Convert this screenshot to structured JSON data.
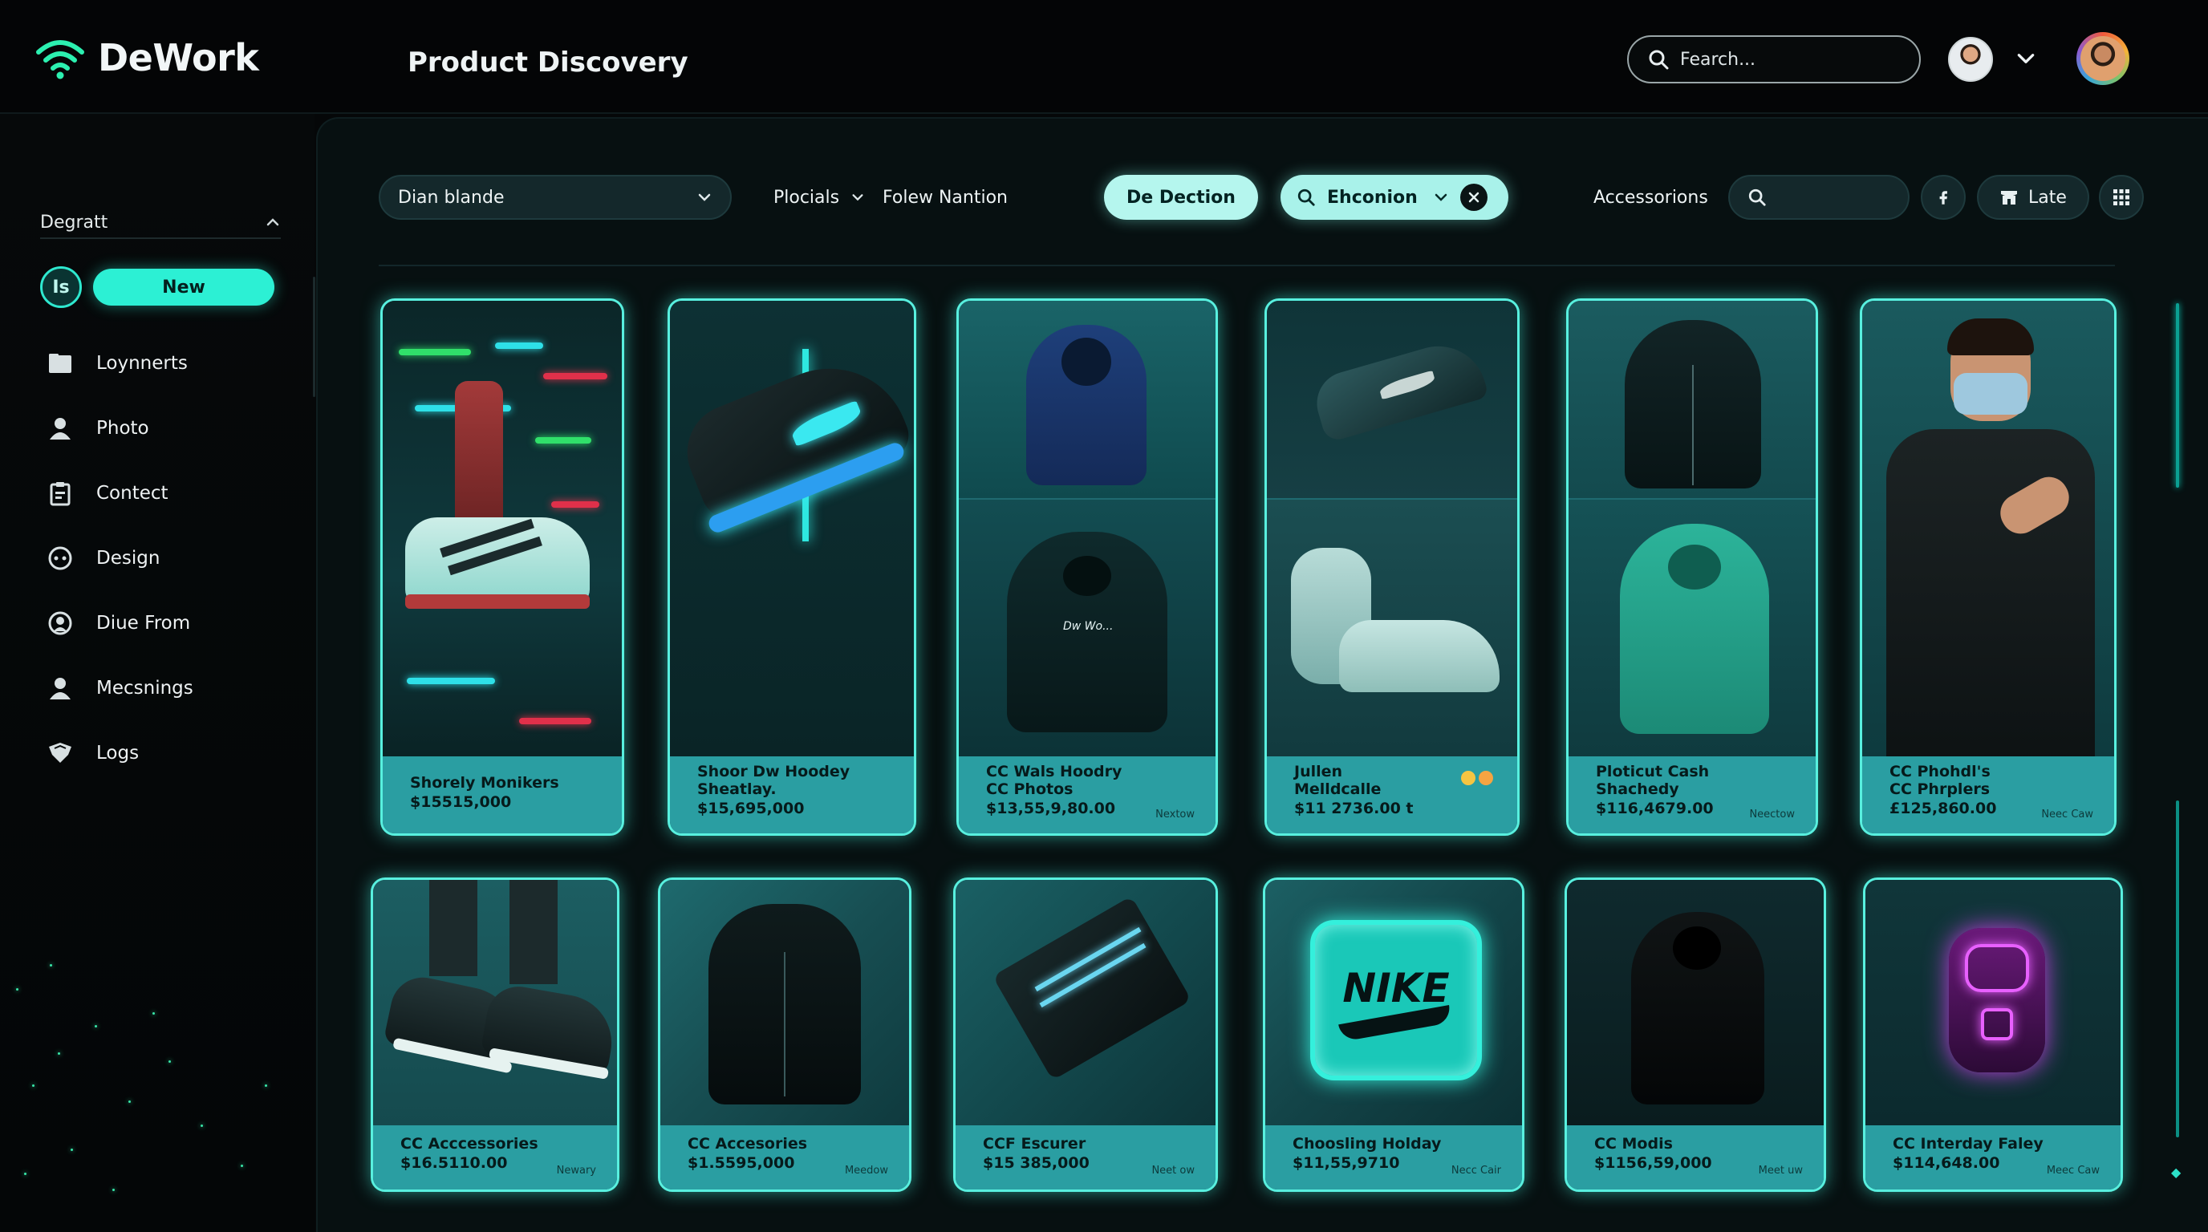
{
  "app": {
    "brand": "DeWork",
    "page_title": "Product Discovery"
  },
  "topbar": {
    "search_placeholder": "Fearch..."
  },
  "colors": {
    "accent": "#2cf0d4",
    "card_glow": "#58f0df",
    "card_info": "#2a9ea2",
    "background": "#050708"
  },
  "sidebar": {
    "section_label": "Degratt",
    "badge_label": "Is",
    "new_label": "New",
    "items": [
      {
        "label": "Loynnerts",
        "icon": "folder-icon"
      },
      {
        "label": "Photo",
        "icon": "user-icon"
      },
      {
        "label": "Contect",
        "icon": "clipboard-icon"
      },
      {
        "label": "Design",
        "icon": "design-icon"
      },
      {
        "label": "Diue From",
        "icon": "profile-circle-icon"
      },
      {
        "label": "Mecsnings",
        "icon": "person-icon"
      },
      {
        "label": "Logs",
        "icon": "shield-icon"
      }
    ]
  },
  "filters": {
    "dropdown_1": "Dian blande",
    "dropdown_2": "Plocials",
    "link_1": "Folew Nantion",
    "active": "De Dection",
    "search_value": "Ehconion",
    "link_2": "Accessorions",
    "sort_label": "Late"
  },
  "products": [
    {
      "name": "Shorely Monikers",
      "price": "$15515,000",
      "tag": ""
    },
    {
      "name": "Shoor Dw Hoodey\nSheatlay.",
      "price": "$15,695,000",
      "tag": ""
    },
    {
      "name": "CC Wals Hoodry\nCC Photos",
      "price": "$13,55,9,80.00",
      "tag": "Nextow"
    },
    {
      "name": "Jullen\nMelldcalle",
      "price": "$11 2736.00 t",
      "tag": ""
    },
    {
      "name": "Ploticut Cash\nShachedy",
      "price": "$116,4679.00",
      "tag": "Neectow"
    },
    {
      "name": "CC Phohdl's\nCC Phrplers",
      "price": "£125,860.00",
      "tag": "Neec Caw"
    },
    {
      "name": "CC Acccessories",
      "price": "$16.5110.00",
      "tag": "Newary"
    },
    {
      "name": "CC Accesories",
      "price": "$1.5595,000",
      "tag": "Meedow"
    },
    {
      "name": "CCF Escurer",
      "price": "$15 385,000",
      "tag": "Neet ow"
    },
    {
      "name": "Choosling Holday",
      "price": "$11,55,9710",
      "tag": "Necc Cair"
    },
    {
      "name": "CC Modis",
      "price": "$1156,59,000",
      "tag": "Meet uw"
    },
    {
      "name": "CC Interday Faley",
      "price": "$114,648.00",
      "tag": "Meec Caw"
    }
  ],
  "logo_text_on_card": "NIKE",
  "hoodie_print": "Dw Wo..."
}
